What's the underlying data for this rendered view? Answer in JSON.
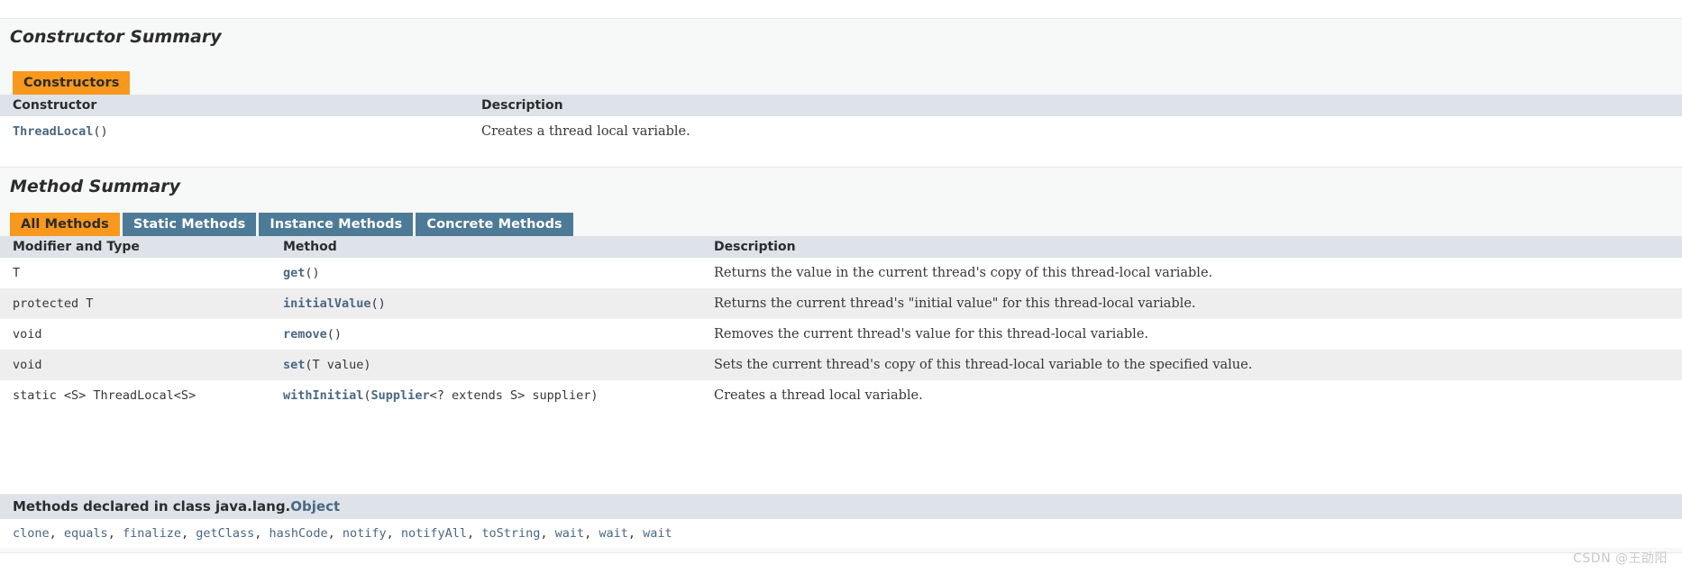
{
  "constructor_section": {
    "title": "Constructor Summary",
    "tabs": [
      {
        "label": "Constructors",
        "active": true
      }
    ],
    "columns": [
      "Constructor",
      "Description"
    ],
    "rows": [
      {
        "constructor_name": "ThreadLocal",
        "constructor_args": "()",
        "description": "Creates a thread local variable."
      }
    ]
  },
  "method_section": {
    "title": "Method Summary",
    "tabs": [
      {
        "label": "All Methods",
        "active": true
      },
      {
        "label": "Static Methods",
        "active": false
      },
      {
        "label": "Instance Methods",
        "active": false
      },
      {
        "label": "Concrete Methods",
        "active": false
      }
    ],
    "columns": [
      "Modifier and Type",
      "Method",
      "Description"
    ],
    "rows": [
      {
        "modifier": "T",
        "method_name": "get",
        "method_args": "()",
        "description": "Returns the value in the current thread's copy of this thread-local variable."
      },
      {
        "modifier": "protected T",
        "method_name": "initialValue",
        "method_args": "()",
        "description": "Returns the current thread's \"initial value\" for this thread-local variable."
      },
      {
        "modifier": "void",
        "method_name": "remove",
        "method_args": "()",
        "description": "Removes the current thread's value for this thread-local variable."
      },
      {
        "modifier": "void",
        "method_name": "set",
        "method_args": "(T value)",
        "description": "Sets the current thread's copy of this thread-local variable to the specified value."
      },
      {
        "modifier": "static <S> ThreadLocal<S>",
        "method_name": "withInitial",
        "method_args_pre": "(",
        "method_args_link": "Supplier",
        "method_args_post": "<? extends S> supplier)",
        "description": "Creates a thread local variable."
      }
    ]
  },
  "inherited_section": {
    "header_prefix": "Methods declared in class java.lang.",
    "header_class": "Object",
    "methods": [
      "clone",
      "equals",
      "finalize",
      "getClass",
      "hashCode",
      "notify",
      "notifyAll",
      "toString",
      "wait",
      "wait",
      "wait"
    ]
  },
  "watermark": {
    "text": "CSDN @王劭阳"
  },
  "colors": {
    "tab_active_bg": "#f8981d",
    "tab_inactive_bg": "#4d7a97",
    "table_header_bg": "#dee3e9",
    "link": "#4a6782",
    "alt_row_bg": "#eeeeef",
    "section_bg": "#f7f8f8"
  }
}
